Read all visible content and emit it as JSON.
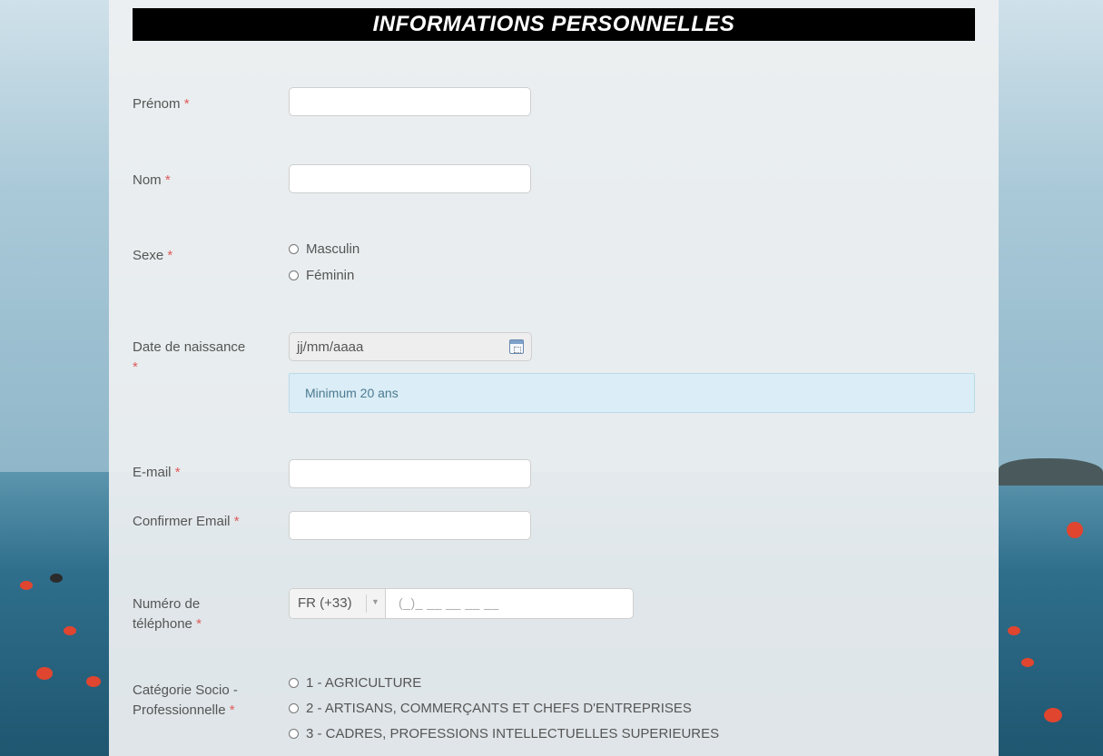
{
  "header": {
    "title": "INFORMATIONS PERSONNELLES"
  },
  "form": {
    "required_marker": "*",
    "prenom": {
      "label": "Prénom",
      "value": ""
    },
    "nom": {
      "label": "Nom",
      "value": ""
    },
    "sexe": {
      "label": "Sexe",
      "options": [
        "Masculin",
        "Féminin"
      ]
    },
    "date_naissance": {
      "label": "Date de naissance",
      "placeholder": "jj/mm/aaaa",
      "hint": "Minimum 20 ans"
    },
    "email": {
      "label": "E-mail",
      "value": ""
    },
    "email_confirm": {
      "label": "Confirmer Email",
      "value": ""
    },
    "telephone": {
      "label_line1": "Numéro de",
      "label_line2": "téléphone",
      "country": "FR (+33)",
      "mask": "(_)_ __ __ __ __"
    },
    "categorie": {
      "label_line1": "Catégorie Socio -",
      "label_line2": "Professionnelle",
      "options": [
        "1 - AGRICULTURE",
        "2 - ARTISANS, COMMERÇANTS ET CHEFS D'ENTREPRISES",
        "3 - CADRES, PROFESSIONS INTELLECTUELLES SUPERIEURES"
      ]
    }
  }
}
